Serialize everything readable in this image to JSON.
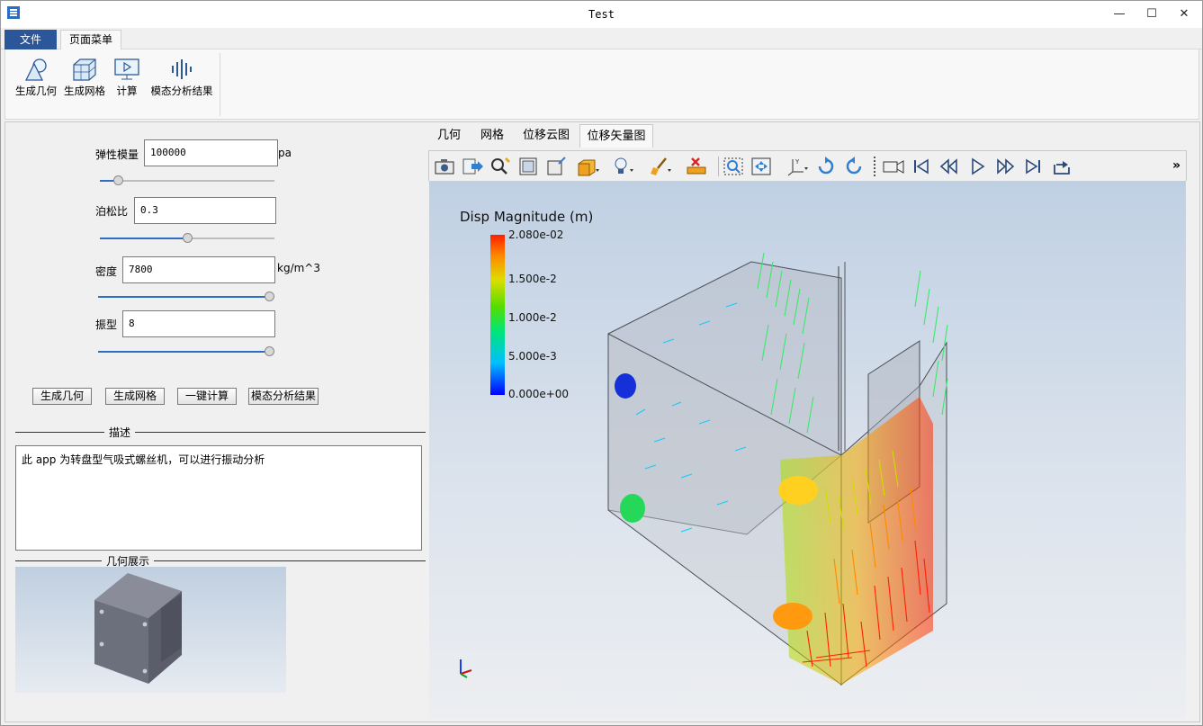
{
  "window": {
    "title": "Test",
    "minimize": "—",
    "maximize": "☐",
    "close": "✕"
  },
  "menu": {
    "file_tab": "文件",
    "page_menu_tab": "页面菜单"
  },
  "ribbon": {
    "gen_geometry": "生成几何",
    "gen_mesh": "生成网格",
    "compute": "计算",
    "modal_results": "模态分析结果"
  },
  "form": {
    "elastic_label": "弹性模量",
    "elastic_value": "100000",
    "elastic_unit": "pa",
    "elastic_slider_level": 0.08,
    "poisson_label": "泊松比",
    "poisson_value": "0.3",
    "poisson_slider_level": 0.5,
    "density_label": "密度",
    "density_value": "7800",
    "density_unit": "kg/m^3",
    "density_slider_level": 1.0,
    "mode_label": "振型",
    "mode_value": "8",
    "mode_slider_level": 1.0
  },
  "buttons": {
    "gen_geometry": "生成几何",
    "gen_mesh": "生成网格",
    "one_click_compute": "一键计算",
    "modal_results": "模态分析结果"
  },
  "description": {
    "title": "描述",
    "text": "此 app 为转盘型气吸式螺丝机，可以进行振动分析"
  },
  "geometry_display": {
    "title": "几何展示"
  },
  "view_tabs": [
    "几何",
    "网格",
    "位移云图",
    "位移矢量图"
  ],
  "active_view_tab": 3,
  "toolbar_overflow": "»",
  "legend": {
    "title": "Disp Magnitude (m)",
    "ticks": [
      "2.080e-02",
      "1.500e-2",
      "1.000e-2",
      "5.000e-3",
      "0.000e+00"
    ]
  },
  "colors": {
    "accent": "#2b579a",
    "slider": "#2e6fc3",
    "legend_max": "#ff1e00",
    "legend_min": "#0000ff"
  }
}
